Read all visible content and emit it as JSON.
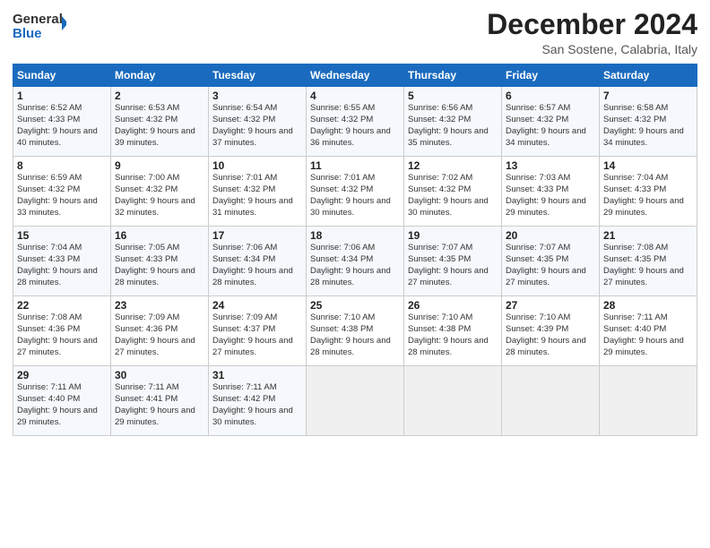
{
  "header": {
    "logo_line1": "General",
    "logo_line2": "Blue",
    "month_title": "December 2024",
    "location": "San Sostene, Calabria, Italy"
  },
  "weekdays": [
    "Sunday",
    "Monday",
    "Tuesday",
    "Wednesday",
    "Thursday",
    "Friday",
    "Saturday"
  ],
  "weeks": [
    [
      {
        "day": "1",
        "sunrise": "Sunrise: 6:52 AM",
        "sunset": "Sunset: 4:33 PM",
        "daylight": "Daylight: 9 hours and 40 minutes."
      },
      {
        "day": "2",
        "sunrise": "Sunrise: 6:53 AM",
        "sunset": "Sunset: 4:32 PM",
        "daylight": "Daylight: 9 hours and 39 minutes."
      },
      {
        "day": "3",
        "sunrise": "Sunrise: 6:54 AM",
        "sunset": "Sunset: 4:32 PM",
        "daylight": "Daylight: 9 hours and 37 minutes."
      },
      {
        "day": "4",
        "sunrise": "Sunrise: 6:55 AM",
        "sunset": "Sunset: 4:32 PM",
        "daylight": "Daylight: 9 hours and 36 minutes."
      },
      {
        "day": "5",
        "sunrise": "Sunrise: 6:56 AM",
        "sunset": "Sunset: 4:32 PM",
        "daylight": "Daylight: 9 hours and 35 minutes."
      },
      {
        "day": "6",
        "sunrise": "Sunrise: 6:57 AM",
        "sunset": "Sunset: 4:32 PM",
        "daylight": "Daylight: 9 hours and 34 minutes."
      },
      {
        "day": "7",
        "sunrise": "Sunrise: 6:58 AM",
        "sunset": "Sunset: 4:32 PM",
        "daylight": "Daylight: 9 hours and 34 minutes."
      }
    ],
    [
      {
        "day": "8",
        "sunrise": "Sunrise: 6:59 AM",
        "sunset": "Sunset: 4:32 PM",
        "daylight": "Daylight: 9 hours and 33 minutes."
      },
      {
        "day": "9",
        "sunrise": "Sunrise: 7:00 AM",
        "sunset": "Sunset: 4:32 PM",
        "daylight": "Daylight: 9 hours and 32 minutes."
      },
      {
        "day": "10",
        "sunrise": "Sunrise: 7:01 AM",
        "sunset": "Sunset: 4:32 PM",
        "daylight": "Daylight: 9 hours and 31 minutes."
      },
      {
        "day": "11",
        "sunrise": "Sunrise: 7:01 AM",
        "sunset": "Sunset: 4:32 PM",
        "daylight": "Daylight: 9 hours and 30 minutes."
      },
      {
        "day": "12",
        "sunrise": "Sunrise: 7:02 AM",
        "sunset": "Sunset: 4:32 PM",
        "daylight": "Daylight: 9 hours and 30 minutes."
      },
      {
        "day": "13",
        "sunrise": "Sunrise: 7:03 AM",
        "sunset": "Sunset: 4:33 PM",
        "daylight": "Daylight: 9 hours and 29 minutes."
      },
      {
        "day": "14",
        "sunrise": "Sunrise: 7:04 AM",
        "sunset": "Sunset: 4:33 PM",
        "daylight": "Daylight: 9 hours and 29 minutes."
      }
    ],
    [
      {
        "day": "15",
        "sunrise": "Sunrise: 7:04 AM",
        "sunset": "Sunset: 4:33 PM",
        "daylight": "Daylight: 9 hours and 28 minutes."
      },
      {
        "day": "16",
        "sunrise": "Sunrise: 7:05 AM",
        "sunset": "Sunset: 4:33 PM",
        "daylight": "Daylight: 9 hours and 28 minutes."
      },
      {
        "day": "17",
        "sunrise": "Sunrise: 7:06 AM",
        "sunset": "Sunset: 4:34 PM",
        "daylight": "Daylight: 9 hours and 28 minutes."
      },
      {
        "day": "18",
        "sunrise": "Sunrise: 7:06 AM",
        "sunset": "Sunset: 4:34 PM",
        "daylight": "Daylight: 9 hours and 28 minutes."
      },
      {
        "day": "19",
        "sunrise": "Sunrise: 7:07 AM",
        "sunset": "Sunset: 4:35 PM",
        "daylight": "Daylight: 9 hours and 27 minutes."
      },
      {
        "day": "20",
        "sunrise": "Sunrise: 7:07 AM",
        "sunset": "Sunset: 4:35 PM",
        "daylight": "Daylight: 9 hours and 27 minutes."
      },
      {
        "day": "21",
        "sunrise": "Sunrise: 7:08 AM",
        "sunset": "Sunset: 4:35 PM",
        "daylight": "Daylight: 9 hours and 27 minutes."
      }
    ],
    [
      {
        "day": "22",
        "sunrise": "Sunrise: 7:08 AM",
        "sunset": "Sunset: 4:36 PM",
        "daylight": "Daylight: 9 hours and 27 minutes."
      },
      {
        "day": "23",
        "sunrise": "Sunrise: 7:09 AM",
        "sunset": "Sunset: 4:36 PM",
        "daylight": "Daylight: 9 hours and 27 minutes."
      },
      {
        "day": "24",
        "sunrise": "Sunrise: 7:09 AM",
        "sunset": "Sunset: 4:37 PM",
        "daylight": "Daylight: 9 hours and 27 minutes."
      },
      {
        "day": "25",
        "sunrise": "Sunrise: 7:10 AM",
        "sunset": "Sunset: 4:38 PM",
        "daylight": "Daylight: 9 hours and 28 minutes."
      },
      {
        "day": "26",
        "sunrise": "Sunrise: 7:10 AM",
        "sunset": "Sunset: 4:38 PM",
        "daylight": "Daylight: 9 hours and 28 minutes."
      },
      {
        "day": "27",
        "sunrise": "Sunrise: 7:10 AM",
        "sunset": "Sunset: 4:39 PM",
        "daylight": "Daylight: 9 hours and 28 minutes."
      },
      {
        "day": "28",
        "sunrise": "Sunrise: 7:11 AM",
        "sunset": "Sunset: 4:40 PM",
        "daylight": "Daylight: 9 hours and 29 minutes."
      }
    ],
    [
      {
        "day": "29",
        "sunrise": "Sunrise: 7:11 AM",
        "sunset": "Sunset: 4:40 PM",
        "daylight": "Daylight: 9 hours and 29 minutes."
      },
      {
        "day": "30",
        "sunrise": "Sunrise: 7:11 AM",
        "sunset": "Sunset: 4:41 PM",
        "daylight": "Daylight: 9 hours and 29 minutes."
      },
      {
        "day": "31",
        "sunrise": "Sunrise: 7:11 AM",
        "sunset": "Sunset: 4:42 PM",
        "daylight": "Daylight: 9 hours and 30 minutes."
      },
      null,
      null,
      null,
      null
    ]
  ]
}
